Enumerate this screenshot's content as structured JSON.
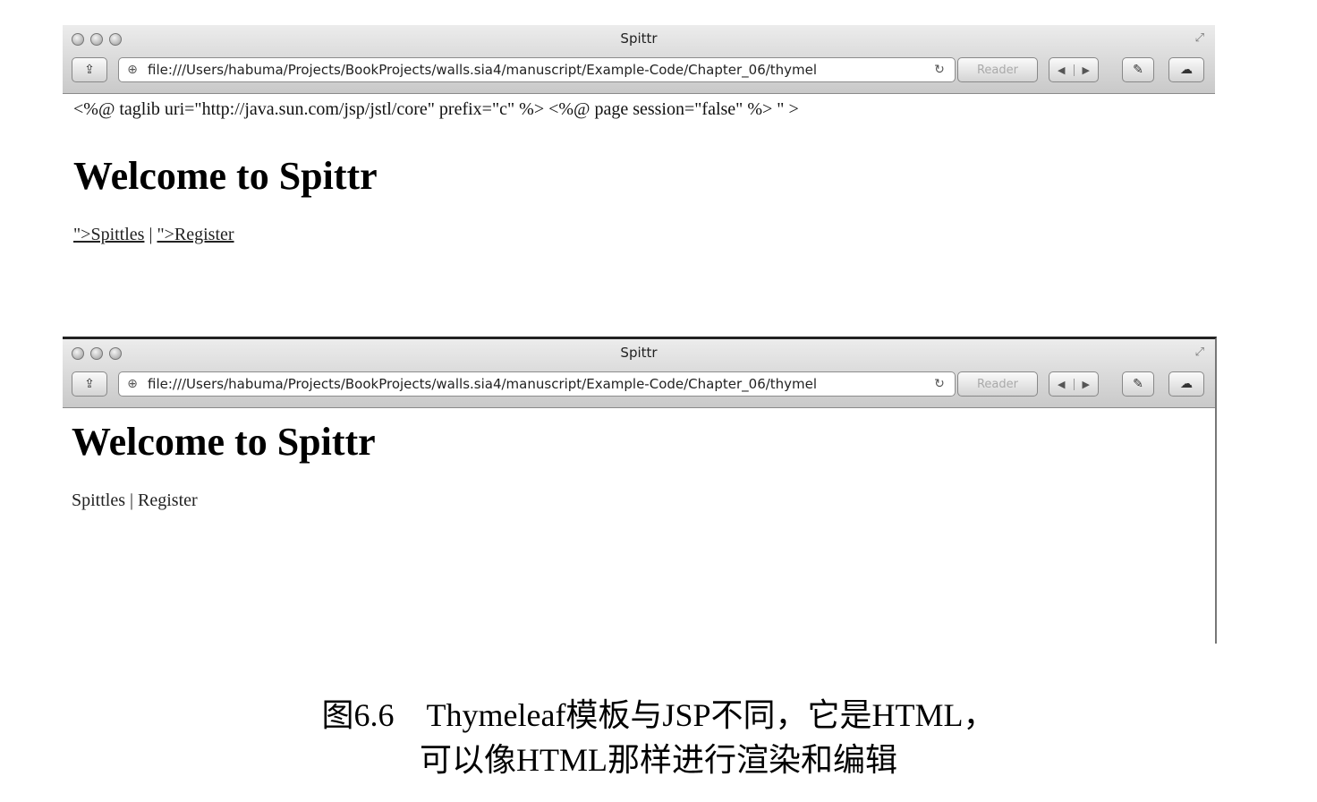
{
  "browser1": {
    "title": "Spittr",
    "url": "file:///Users/habuma/Projects/BookProjects/walls.sia4/manuscript/Example-Code/Chapter_06/thymel",
    "reader_label": "Reader",
    "jsp_line": "<%@ taglib uri=\"http://java.sun.com/jsp/jstl/core\" prefix=\"c\" %> <%@ page session=\"false\" %> \" >",
    "heading": "Welcome to Spittr",
    "link_spittles": "\">Spittles",
    "separator": " | ",
    "link_register": "\">Register"
  },
  "browser2": {
    "title": "Spittr",
    "url": "file:///Users/habuma/Projects/BookProjects/walls.sia4/manuscript/Example-Code/Chapter_06/thymel",
    "reader_label": "Reader",
    "heading": "Welcome to Spittr",
    "link_spittles": "Spittles",
    "separator": " | ",
    "link_register": "Register"
  },
  "caption": {
    "line1": "图6.6　Thymeleaf模板与JSP不同，它是HTML，",
    "line2": "可以像HTML那样进行渲染和编辑"
  },
  "icons": {
    "traffic_lights": "window-control-icons",
    "share": "share-icon",
    "globe": "globe-icon",
    "reload": "reload-icon",
    "back": "back-arrow-icon",
    "forward": "forward-arrow-icon",
    "tools": "wrench-icon",
    "cloud": "cloud-icon",
    "resize": "fullscreen-icon"
  }
}
